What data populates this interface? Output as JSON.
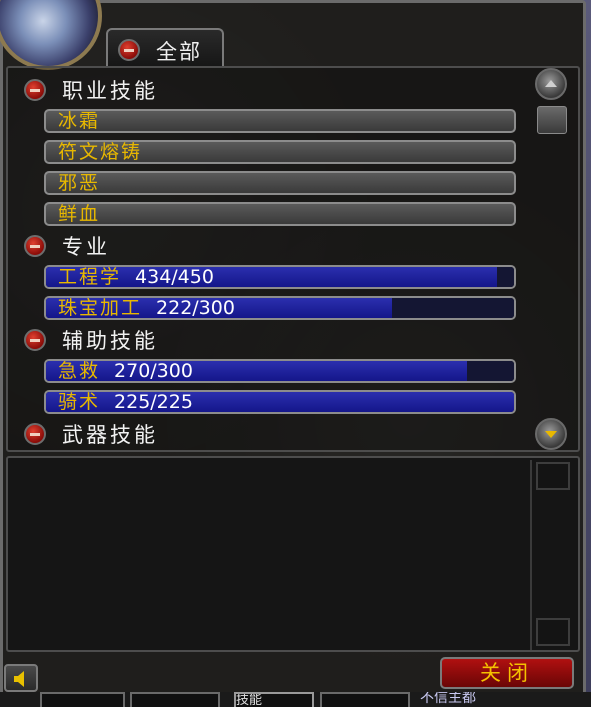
{
  "tab": {
    "label": "全部"
  },
  "categories": [
    {
      "label": "职业技能",
      "skills": [
        {
          "name": "冰霜"
        },
        {
          "name": "符文熔铸"
        },
        {
          "name": "邪恶"
        },
        {
          "name": "鲜血"
        }
      ]
    },
    {
      "label": "专业",
      "skills": [
        {
          "name": "工程学",
          "value": "434/450",
          "progress": 0.964
        },
        {
          "name": "珠宝加工",
          "value": "222/300",
          "progress": 0.74
        }
      ]
    },
    {
      "label": "辅助技能",
      "skills": [
        {
          "name": "急救",
          "value": "270/300",
          "progress": 0.9
        },
        {
          "name": "骑术",
          "value": "225/225",
          "progress": 1.0
        }
      ]
    },
    {
      "label": "武器技能",
      "skills": []
    }
  ],
  "buttons": {
    "close": "关闭"
  },
  "bottom_tabs": [
    "",
    "",
    "技能",
    ""
  ],
  "partial_text": "不信主都",
  "colors": {
    "skill_name": "#e8b800",
    "bar_fill": "#1f22a0",
    "close_bg": "#9a0c0c"
  }
}
